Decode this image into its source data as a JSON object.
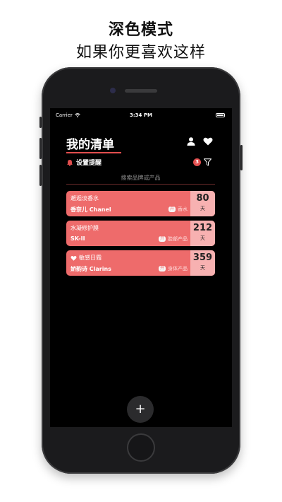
{
  "promo": {
    "title": "深色模式",
    "subtitle": "如果你更喜欢这样"
  },
  "status_bar": {
    "carrier": "Carrier",
    "time": "3:34 PM"
  },
  "header": {
    "title": "我的清单",
    "reminder_label": "设置提醒",
    "badge_count": "3"
  },
  "search": {
    "placeholder": "搜索品牌或产品"
  },
  "items": [
    {
      "name": "邂逅淡香水",
      "brand": "香奈儿 Chanel",
      "tag": "开",
      "category": "香水",
      "days": "80",
      "unit": "天",
      "favorite": false
    },
    {
      "name": "水凝修护膜",
      "brand": "SK-II",
      "tag": "开",
      "category": "脸部产品",
      "days": "212",
      "unit": "天",
      "favorite": false
    },
    {
      "name": "敏感日霜",
      "brand": "娇韵诗 Clarins",
      "tag": "开",
      "category": "身体产品",
      "days": "359",
      "unit": "天",
      "favorite": true
    }
  ],
  "fab": {
    "label": "+"
  },
  "colors": {
    "accent": "#e24e4e",
    "card": "#ee6b6b",
    "card_days": "#f7b1b1",
    "background": "#000000"
  },
  "icons": [
    "wifi-icon",
    "battery-icon",
    "user-icon",
    "heart-icon",
    "bell-icon",
    "filter-icon",
    "plus-icon"
  ]
}
